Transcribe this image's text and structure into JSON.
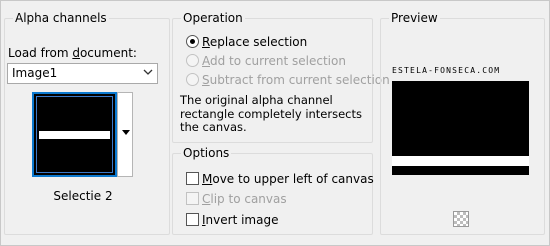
{
  "alpha_channels": {
    "title": "Alpha channels",
    "load_label_prefix": "Load from ",
    "load_label_u": "d",
    "load_label_suffix": "ocument:",
    "document_value": "Image1",
    "selection_name": "Selectie 2"
  },
  "operation": {
    "title": "Operation",
    "options": [
      {
        "u": "R",
        "rest": "eplace selection",
        "selected": true,
        "enabled": true
      },
      {
        "u": "A",
        "rest": "dd to current selection",
        "selected": false,
        "enabled": false
      },
      {
        "u": "S",
        "rest": "ubtract from current selection",
        "selected": false,
        "enabled": false
      }
    ],
    "description": "The original alpha channel rectangle completely intersects the canvas."
  },
  "options": {
    "title": "Options",
    "items": [
      {
        "u": "M",
        "rest": "ove to upper left of canvas",
        "checked": false,
        "enabled": true
      },
      {
        "u": "C",
        "rest": "lip to canvas",
        "checked": false,
        "enabled": false
      },
      {
        "u": "I",
        "rest": "nvert image",
        "checked": false,
        "enabled": true
      }
    ]
  },
  "preview": {
    "title": "Preview",
    "watermark": "ESTELA-FONSECA.COM"
  }
}
